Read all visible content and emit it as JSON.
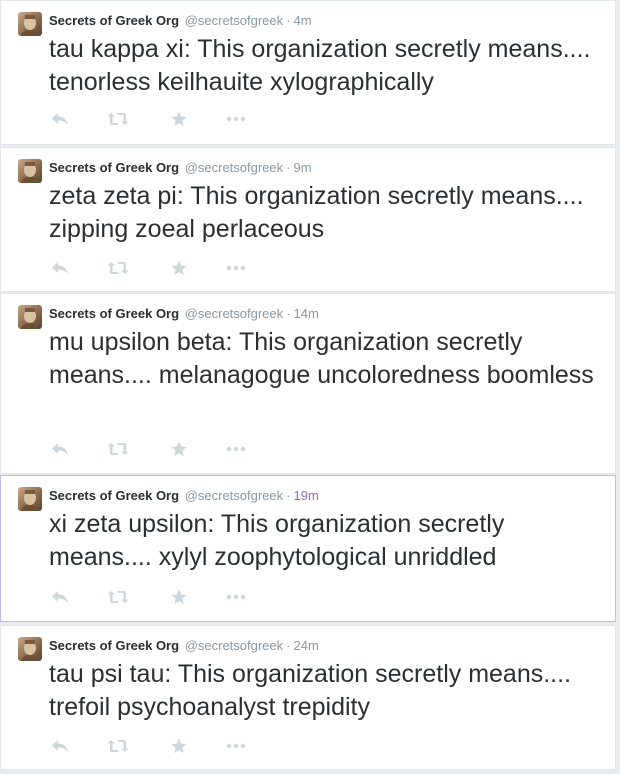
{
  "tweets": [
    {
      "name": "Secrets of Greek Org",
      "handle": "@secretsofgreek",
      "separator": "·",
      "time": "4m",
      "text": "tau kappa xi: This organization secretly means.... tenorless keilhauite xylographically"
    },
    {
      "name": "Secrets of Greek Org",
      "handle": "@secretsofgreek",
      "separator": "·",
      "time": "9m",
      "text": "zeta zeta pi: This organization secretly means.... zipping zoeal perlaceous"
    },
    {
      "name": "Secrets of Greek Org",
      "handle": "@secretsofgreek",
      "separator": "·",
      "time": "14m",
      "text": "mu upsilon beta: This organization secretly means.... melanagogue uncoloredness boomless"
    },
    {
      "name": "Secrets of Greek Org",
      "handle": "@secretsofgreek",
      "separator": "·",
      "time": "19m",
      "text": "xi zeta upsilon: This organization secretly means.... xylyl zoophytological unriddled"
    },
    {
      "name": "Secrets of Greek Org",
      "handle": "@secretsofgreek",
      "separator": "·",
      "time": "24m",
      "text": "tau psi tau: This organization secretly means.... trefoil psychoanalyst trepidity"
    }
  ],
  "icons": {
    "reply": "reply-icon",
    "retweet": "retweet-icon",
    "favorite": "star-icon",
    "more": "more-icon"
  },
  "colors": {
    "icon": "#ccd6dd",
    "meta": "#8899a6",
    "text": "#292f33",
    "hover_border": "#c5b7e8",
    "hover_time": "#9566d6"
  }
}
